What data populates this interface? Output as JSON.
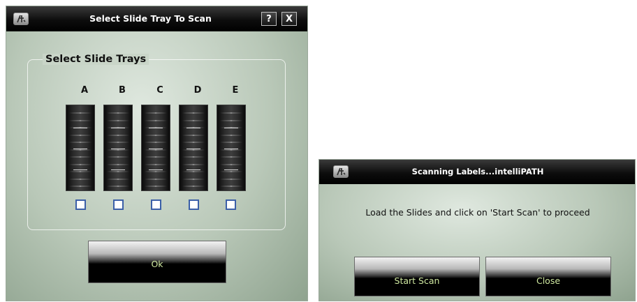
{
  "tray_dialog": {
    "title": "Select Slide Tray To Scan",
    "help_label": "?",
    "close_label": "X",
    "group_title": "Select Slide Trays",
    "trays": [
      {
        "label": "A",
        "checked": false
      },
      {
        "label": "B",
        "checked": false
      },
      {
        "label": "C",
        "checked": false
      },
      {
        "label": "D",
        "checked": false
      },
      {
        "label": "E",
        "checked": false
      }
    ],
    "ok_label": "Ok"
  },
  "scan_dialog": {
    "title": "Scanning Labels...intelliPATH",
    "message": "Load the Slides and click on 'Start Scan' to proceed",
    "start_label": "Start Scan",
    "close_label": "Close"
  },
  "colors": {
    "button_text": "#cfe8a0",
    "checkbox_border": "#3b5fa8",
    "titlebar": "#000000"
  },
  "icons": {
    "app": "app-logo-icon"
  }
}
